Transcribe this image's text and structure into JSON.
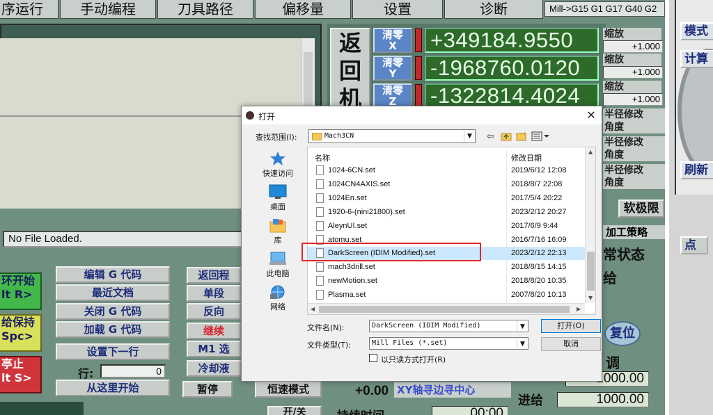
{
  "mach3": {
    "tabs": [
      "序运行",
      "手动编程",
      "刀具路径",
      "偏移量",
      "设置",
      "诊断"
    ],
    "status_strip": "Mill->G15  G1 G17 G40 G2",
    "file_loaded": "No File Loaded.",
    "dro_side": "返回机",
    "zero_buttons": [
      "清零\nX",
      "清零\nY",
      "清零\nZ"
    ],
    "dro_values": [
      "+349184.9550",
      "-1968760.0120",
      "-1322814.4024"
    ],
    "scale_label": "缩放",
    "scale_value": "+1.000",
    "right_labels": [
      "半径修改",
      "角度",
      "半径修改",
      "角度",
      "半径修改",
      "角度"
    ],
    "soft_limits": "软极限",
    "strategy": "加工策略",
    "normal_status": "常状态",
    "feed_label": "给",
    "reset": "复位",
    "adjust": "调",
    "feed_bottom": "进给",
    "vals": [
      "1000.00",
      "1000.00"
    ],
    "green_btn": "环开始\nlt R>",
    "yellow_btn": "给保持\nSpc>",
    "red_btn": "亭止\nlt S>",
    "gcode_buttons": [
      "编辑 G 代码",
      "最近文档",
      "关闭 G 代码",
      "加载 G 代码",
      "设置下一行",
      "从这里开始"
    ],
    "mid_buttons": [
      "返回程",
      "单段",
      "反向",
      "继续",
      "M1 选",
      "冷却液"
    ],
    "line_label": "行:",
    "line_value": "0",
    "pause": "暂停",
    "const_speed": "恒速模式",
    "offset_val": "+0.00",
    "xy_edge": "XY轴寻边寻中心",
    "duration": "持续时间",
    "time_val": "00:00",
    "toggle": "开/关"
  },
  "right_panel": {
    "buttons": [
      "模式",
      "计算",
      "刷新",
      "点"
    ]
  },
  "dialog": {
    "title": "打开",
    "look_in_label": "查找范围(I):",
    "look_in_value": "Mach3CN",
    "places": [
      "快速访问",
      "桌面",
      "库",
      "此电脑",
      "网络"
    ],
    "columns": {
      "name": "名称",
      "date": "修改日期"
    },
    "files": [
      {
        "name": "1024-6CN.set",
        "date": "2019/6/12 12:08"
      },
      {
        "name": "1024CN4AXIS.set",
        "date": "2018/8/7 22:08"
      },
      {
        "name": "1024En.set",
        "date": "2017/5/4 20:22"
      },
      {
        "name": "1920-6-(nini21800).set",
        "date": "2023/2/12 20:27"
      },
      {
        "name": "AleynUI.set",
        "date": "2017/6/9 9:44"
      },
      {
        "name": "atomu.set",
        "date": "2016/7/16 16:09"
      },
      {
        "name": "DarkScreen (IDIM Modified).set",
        "date": "2023/2/12 22:13",
        "selected": true
      },
      {
        "name": "mach3drill.set",
        "date": "2018/8/15 14:15"
      },
      {
        "name": "newMotion.set",
        "date": "2018/8/20 10:35"
      },
      {
        "name": "Plasma.set",
        "date": "2007/8/20 10:13"
      }
    ],
    "filename_label": "文件名(N):",
    "filename_value": "DarkScreen (IDIM Modified)",
    "filetype_label": "文件类型(T):",
    "filetype_value": "Mill Files (*.set)",
    "readonly_label": "以只读方式打开(R)",
    "open_button": "打开(O)",
    "cancel_button": "取消"
  }
}
